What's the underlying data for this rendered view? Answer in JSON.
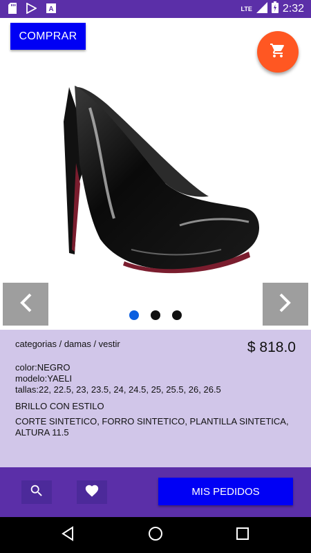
{
  "status_bar": {
    "time": "2:32",
    "network": "LTE",
    "icons": [
      "sd-card-icon",
      "play-store-icon",
      "text-icon",
      "signal-icon",
      "battery-icon"
    ]
  },
  "header": {
    "buy_label": "COMPRAR",
    "cart_icon": "shopping-cart-icon",
    "cart_color": "#ff5722"
  },
  "gallery": {
    "dots_total": 3,
    "active_dot": 0,
    "prev_icon": "chevron-left-icon",
    "next_icon": "chevron-right-icon",
    "image_icon": "high-heel-shoe-icon"
  },
  "product": {
    "breadcrumb": "categorias / damas / vestir",
    "price": "$ 818.0",
    "color": "color:NEGRO",
    "model": "modelo:YAELI",
    "sizes": "tallas:22, 22.5, 23, 23.5, 24, 24.5, 25, 25.5, 26, 26.5",
    "tagline": "BRILLO CON ESTILO",
    "description": "CORTE SINTETICO, FORRO SINTETICO, PLANTILLA SINTETICA, ALTURA 11.5"
  },
  "bottom_bar": {
    "search_icon": "search-icon",
    "favorite_icon": "heart-icon",
    "orders_label": "MIS PEDIDOS"
  },
  "colors": {
    "primary": "#5b2fa8",
    "button_blue": "#0000f5",
    "info_bg": "#d1c6e9",
    "dot_active": "#0b5fe0"
  }
}
